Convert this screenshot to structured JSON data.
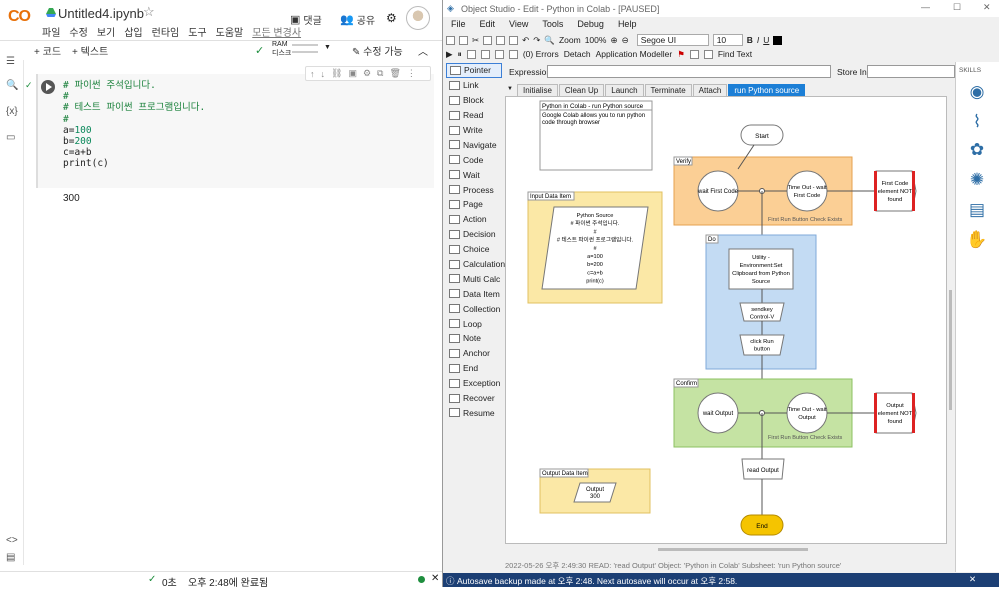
{
  "colab": {
    "logo": "CO",
    "notebook_title": "Untitled4.ipynb",
    "menu": [
      "파일",
      "수정",
      "보기",
      "삽입",
      "런타임",
      "도구",
      "도움말"
    ],
    "menu_last": "모든 변경사",
    "comment_button": "댓글",
    "share_button": "공유",
    "add_code": "+ 코드",
    "add_text": "+ 텍스트",
    "ram_label": "RAM",
    "disk_label": "디스크",
    "edit_mode": "수정 가능",
    "code_lines": [
      {
        "t": "# 파이썬 주석입니다.",
        "k": "comment"
      },
      {
        "t": "#",
        "k": "comment"
      },
      {
        "t": "# 테스트 파이썬 프로그램입니다.",
        "k": "comment"
      },
      {
        "t": "#",
        "k": "comment"
      },
      {
        "t": "a=",
        "n": "100",
        "k": "num"
      },
      {
        "t": "b=",
        "n": "200",
        "k": "num"
      },
      {
        "t": "c=a+b",
        "k": "plain"
      },
      {
        "t": "print(c)",
        "k": "plain"
      }
    ],
    "output": "300",
    "status_time": "0초",
    "status_text": "오후 2:48에 완료됨"
  },
  "studio": {
    "window_title": "Object Studio  - Edit - Python in Colab - [PAUSED]",
    "menu": [
      "File",
      "Edit",
      "View",
      "Tools",
      "Debug",
      "Help"
    ],
    "zoom_label": "Zoom",
    "zoom_value": "100%",
    "font_name": "Segoe UI",
    "font_size": "10",
    "bold": "B",
    "italic": "I",
    "underline": "U",
    "errors": "(0) Errors",
    "detach": "Detach",
    "app_modeller": "Application Modeller",
    "find_text": "Find Text",
    "expression_label": "Expression:",
    "store_in_label": "Store In:",
    "skills_label": "SKILLS",
    "tools": [
      "Pointer",
      "Link",
      "Block",
      "Read",
      "Write",
      "Navigate",
      "Code",
      "Wait",
      "Process",
      "Page",
      "Action",
      "Decision",
      "Choice",
      "Calculation",
      "Multi Calc",
      "Data Item",
      "Collection",
      "Loop",
      "Note",
      "Anchor",
      "End",
      "Exception",
      "Recover",
      "Resume"
    ],
    "tabs": [
      "Initialise",
      "Clean Up",
      "Launch",
      "Terminate",
      "Attach",
      "run Python source"
    ],
    "active_tab": "run Python source",
    "diagram": {
      "info_title": "Python in Colab - run Python source",
      "info_text1": "Google Colab allows you to run python",
      "info_text2": "code through browser",
      "input_block": "Input Data Item",
      "input_lines": [
        "Python Source",
        "# 파이썬 주석입니다.",
        "#",
        "# 테스트 파이썬 프로그램입니다.",
        "#",
        "a=100",
        "b=200",
        "c=a+b",
        "print(c)"
      ],
      "verify_block": "Verify",
      "start": "Start",
      "wait_first_code": "wait First Code",
      "timeout_first_1": "Time Out - wait",
      "timeout_first_2": "First Code",
      "exc1_lines": [
        "First Code",
        "element NOT",
        "found"
      ],
      "check1": "First Run Button Check Exists",
      "do_block": "Do",
      "utility_lines": [
        "Utility -",
        "Environment:Set",
        "Clipboard from Python",
        "Source"
      ],
      "sendkey_lines": [
        "sendkey",
        "Control-V"
      ],
      "click_lines": [
        "click Run",
        "button"
      ],
      "confirm_block": "Confirm",
      "wait_output": "wait Output",
      "timeout_out_1": "Time Out - wait",
      "timeout_out_2": "Output",
      "exc2_lines": [
        "Output",
        "element NOT",
        "found"
      ],
      "check2": "First Run Button Check Exists",
      "read_output": "read Output",
      "output_block": "Output Data Item",
      "output_name": "Output",
      "output_value": "300",
      "end": "End"
    },
    "status_line": "2022-05-26 오후 2:49:30 READ: 'read Output'  Object: 'Python in Colab'  Subsheet: 'run Python source'",
    "autosave": "Autosave backup made at 오후 2:48. Next autosave will occur at 오후 2:58."
  }
}
